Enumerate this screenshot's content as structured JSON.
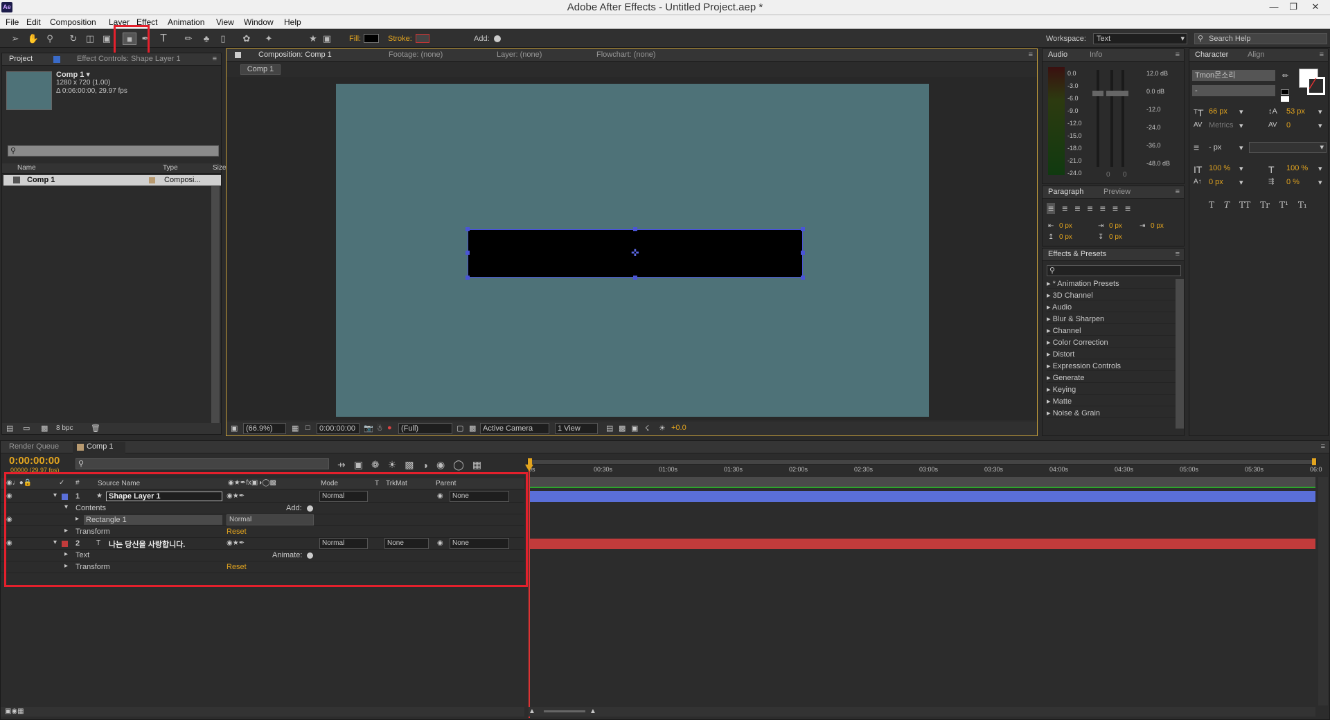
{
  "window": {
    "title": "Adobe After Effects - Untitled Project.aep *",
    "app_icon": "Ae"
  },
  "menu": [
    "File",
    "Edit",
    "Composition",
    "Layer",
    "Effect",
    "Animation",
    "View",
    "Window",
    "Help"
  ],
  "toolbar": {
    "fill_label": "Fill:",
    "stroke_label": "Stroke:",
    "add_label": "Add:",
    "workspace_label": "Workspace:",
    "workspace_value": "Text",
    "search_placeholder": "Search Help"
  },
  "project": {
    "tab_project": "Project",
    "tab_effect_controls": "Effect Controls: Shape Layer 1",
    "comp_name": "Comp 1 ▾",
    "comp_size": "1280 x 720 (1.00)",
    "comp_duration": "Δ 0:06:00:00, 29.97 fps",
    "col_name": "Name",
    "col_type": "Type",
    "col_size": "Size",
    "item_name": "Comp 1",
    "item_type": "Composi...",
    "bpc": "8 bpc"
  },
  "viewer": {
    "tab_comp": "Composition: Comp 1",
    "tab_footage": "Footage: (none)",
    "tab_layer": "Layer: (none)",
    "tab_flowchart": "Flowchart: (none)",
    "crumb": "Comp 1",
    "zoom": "(66.9%)",
    "time": "0:00:00:00",
    "res": "(Full)",
    "camera": "Active Camera",
    "views": "1 View",
    "exposure": "+0.0",
    "bg_color": "#4e7278"
  },
  "audio": {
    "tab_audio": "Audio",
    "tab_info": "Info",
    "left_scale": [
      "0.0",
      "-3.0",
      "-6.0",
      "-9.0",
      "-12.0",
      "-15.0",
      "-18.0",
      "-21.0",
      "-24.0"
    ],
    "right_scale": [
      "12.0 dB",
      "0.0 dB",
      "-12.0",
      "-24.0",
      "-36.0",
      "-48.0 dB"
    ],
    "slider_zero_a": "0",
    "slider_zero_b": "0"
  },
  "character": {
    "tab_character": "Character",
    "tab_align": "Align",
    "font_name": "Tmon몬소리",
    "font_style": "-",
    "font_size": "66 px",
    "leading": "53 px",
    "kerning": "Metrics",
    "tracking": "0",
    "stroke_width": "- px",
    "vscale": "100 %",
    "hscale": "100 %",
    "baseline": "0 px",
    "tsume": "0 %",
    "styles": [
      "T",
      "T",
      "TT",
      "Tr",
      "T¹",
      "T₁"
    ]
  },
  "paragraph": {
    "tab_paragraph": "Paragraph",
    "tab_preview": "Preview",
    "indent_left": "0 px",
    "indent_right": "0 px",
    "indent_first": "0 px",
    "space_before": "0 px",
    "space_after": "0 px"
  },
  "effects": {
    "tab": "Effects & Presets",
    "items": [
      "* Animation Presets",
      "3D Channel",
      "Audio",
      "Blur & Sharpen",
      "Channel",
      "Color Correction",
      "Distort",
      "Expression Controls",
      "Generate",
      "Keying",
      "Matte",
      "Noise & Grain"
    ]
  },
  "timeline": {
    "tab_render": "Render Queue",
    "tab_comp": "Comp 1",
    "timecode": "0:00:00:00",
    "frames": "00000 (29.97 fps)",
    "col_source": "Source Name",
    "col_mode": "Mode",
    "col_t": "T",
    "col_trkmat": "TrkMat",
    "col_parent": "Parent",
    "ruler": [
      "0s",
      "00:30s",
      "01:00s",
      "01:30s",
      "02:00s",
      "02:30s",
      "03:00s",
      "03:30s",
      "04:00s",
      "04:30s",
      "05:00s",
      "05:30s",
      "06:0"
    ],
    "layer1": {
      "num": "1",
      "name": "Shape Layer 1",
      "mode": "Normal",
      "parent": "None",
      "color": "#5a6fd8"
    },
    "contents_label": "Contents",
    "add_label": "Add:",
    "rect_label": "Rectangle 1",
    "rect_mode": "Normal",
    "transform_label": "Transform",
    "reset_label": "Reset",
    "layer2": {
      "num": "2",
      "name": "나는 당신을 사랑합니다.",
      "mode": "Normal",
      "trkmat": "None",
      "parent": "None",
      "color": "#c23b3b"
    },
    "text_label": "Text",
    "animate_label": "Animate:",
    "transform2_label": "Transform",
    "reset2_label": "Reset"
  }
}
